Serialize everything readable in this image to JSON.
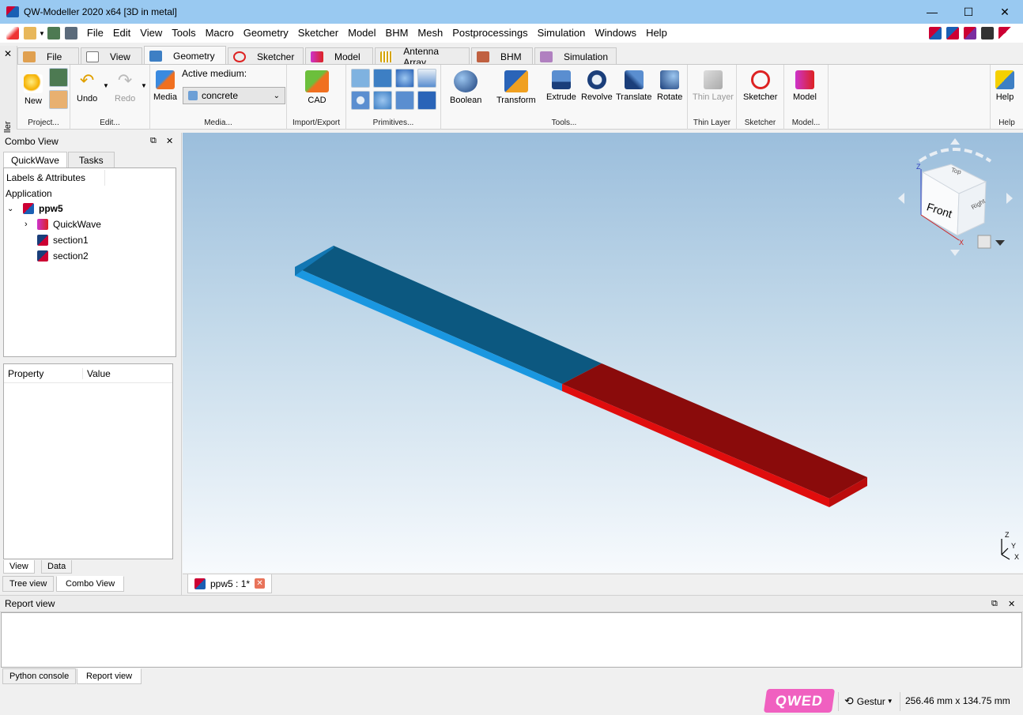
{
  "window": {
    "title": "QW-Modeller 2020 x64 [3D in metal]"
  },
  "menu": [
    "File",
    "Edit",
    "View",
    "Tools",
    "Macro",
    "Geometry",
    "Sketcher",
    "Model",
    "BHM",
    "Mesh",
    "Postprocessings",
    "Simulation",
    "Windows",
    "Help"
  ],
  "side_label": "QW-Modeller",
  "tabs": [
    "File",
    "View",
    "Geometry",
    "Sketcher",
    "Model",
    "Antenna Array",
    "BHM",
    "Simulation"
  ],
  "ribbon": {
    "new": "New",
    "project_group": "Project...",
    "undo": "Undo",
    "redo": "Redo",
    "edit_group": "Edit...",
    "media": "Media",
    "active_medium_label": "Active medium:",
    "active_medium_value": "concrete",
    "media_group": "Media...",
    "cad": "CAD",
    "import_export_group": "Import/Export",
    "primitives_group": "Primitives...",
    "boolean": "Boolean",
    "transform": "Transform",
    "extrude": "Extrude",
    "revolve": "Revolve",
    "translate": "Translate",
    "rotate": "Rotate",
    "tools_group": "Tools...",
    "thin_layer": "Thin Layer",
    "thin_layer_group": "Thin Layer",
    "sketcher": "Sketcher",
    "sketcher_group": "Sketcher",
    "model": "Model",
    "model_group": "Model...",
    "help": "Help",
    "help_group": "Help"
  },
  "combo": {
    "title": "Combo View",
    "tabs": [
      "QuickWave",
      "Tasks"
    ],
    "tree": {
      "labels": "Labels & Attributes",
      "application": "Application",
      "root": "ppw5",
      "children": [
        "QuickWave",
        "section1",
        "section2"
      ]
    },
    "property_header": "Property",
    "value_header": "Value",
    "bottom_tabs": [
      "View",
      "Data"
    ]
  },
  "left_tabs": [
    "Tree view",
    "Combo View"
  ],
  "viewport": {
    "cube_face": "Front",
    "cube_top": "Top",
    "cube_right": "Right",
    "axes": {
      "z": "Z",
      "x": "X",
      "y": "Y"
    },
    "colors": {
      "section1": "#0c5880",
      "section1_edge": "#1a97e0",
      "section2": "#8a0b0b",
      "section2_edge": "#e00d0d"
    }
  },
  "doc_tab": "ppw5 : 1*",
  "report": {
    "title": "Report view",
    "tabs": [
      "Python console",
      "Report view"
    ]
  },
  "status": {
    "logo": "QWED",
    "nav_style": "Gestur",
    "dimensions": "256.46 mm x 134.75 mm"
  }
}
